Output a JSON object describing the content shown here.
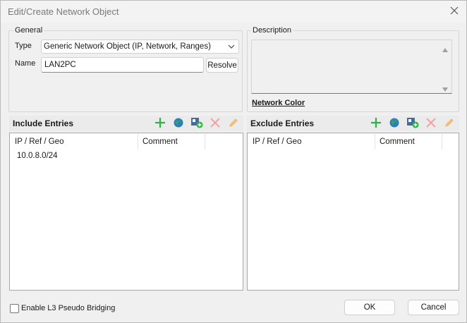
{
  "window": {
    "title": "Edit/Create Network Object",
    "close_icon": "close-icon"
  },
  "general": {
    "legend": "General",
    "type_label": "Type",
    "type_value": "Generic Network Object (IP, Network, Ranges)",
    "name_label": "Name",
    "name_value": "LAN2PC",
    "resolve_label": "Resolve"
  },
  "description": {
    "legend": "Description",
    "value": "",
    "network_color_label": "Network Color"
  },
  "include": {
    "title": "Include Entries",
    "columns": [
      "IP / Ref / Geo",
      "Comment"
    ],
    "rows": [
      {
        "ip": "10.0.8.0/24",
        "comment": ""
      }
    ],
    "toolbar": [
      "add-icon",
      "globe-icon",
      "add-object-icon",
      "delete-icon",
      "edit-icon"
    ]
  },
  "exclude": {
    "title": "Exclude Entries",
    "columns": [
      "IP / Ref / Geo",
      "Comment"
    ],
    "rows": [],
    "toolbar": [
      "add-icon",
      "globe-icon",
      "add-object-icon",
      "delete-icon",
      "edit-icon"
    ]
  },
  "footer": {
    "bridging_label": "Enable L3 Pseudo Bridging",
    "bridging_checked": false,
    "ok_label": "OK",
    "cancel_label": "Cancel"
  },
  "colors": {
    "add": "#2fb344",
    "delete": "#f2a3a3",
    "edit": "#f3c58a",
    "globe": "#2a7fbf"
  }
}
